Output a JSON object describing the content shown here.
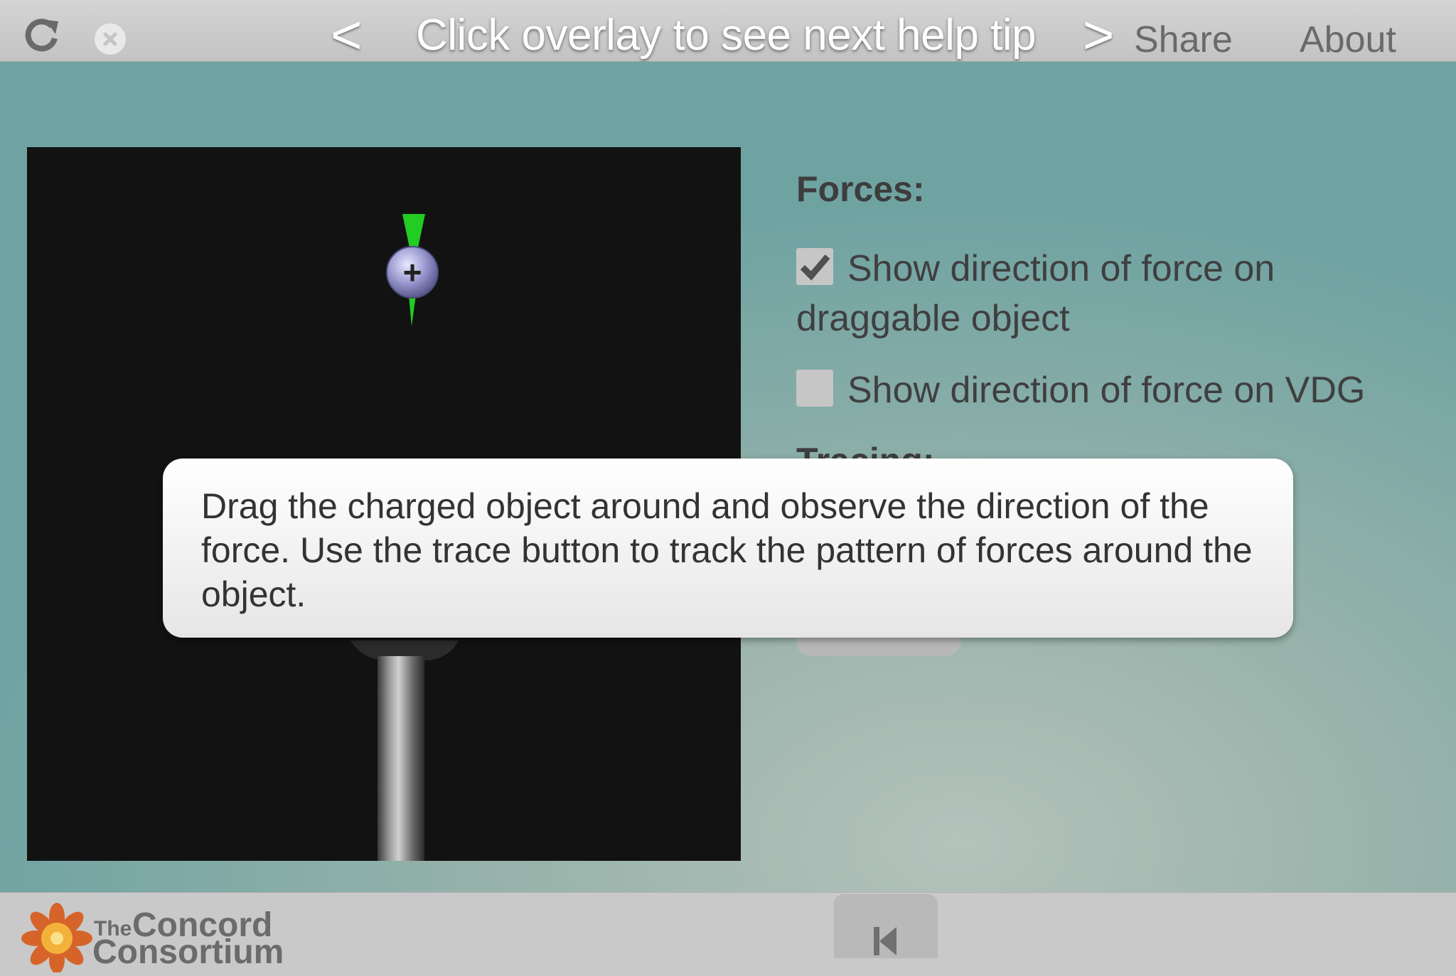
{
  "topbar": {
    "reload_icon": "reload-icon",
    "close_icon": "close-circle-icon",
    "prev_label": "<",
    "help_title": "Click overlay to see next help tip",
    "next_label": ">",
    "share_label": "Share",
    "about_label": "About"
  },
  "controls": {
    "forces_heading": "Forces:",
    "option1_label": "Show direction of force on draggable object",
    "option1_checked": true,
    "option2_label": "Show direction of force on VDG",
    "option2_checked": false,
    "tracing_heading": "Tracing:"
  },
  "simulation": {
    "charge_symbol": "+",
    "force_arrow_color": "#22cc22",
    "background_color": "#121212"
  },
  "tip": {
    "text": "Drag the charged object around and observe the direction of the force. Use the trace button to track the pattern of forces around the object."
  },
  "footer": {
    "logo_the": "The",
    "logo_concord": "Concord",
    "logo_consortium": "Consortium",
    "reset_icon": "skip-to-start-icon"
  },
  "colors": {
    "accent_teal": "#6fa3a2",
    "bar_gray": "#c9c9c9"
  }
}
